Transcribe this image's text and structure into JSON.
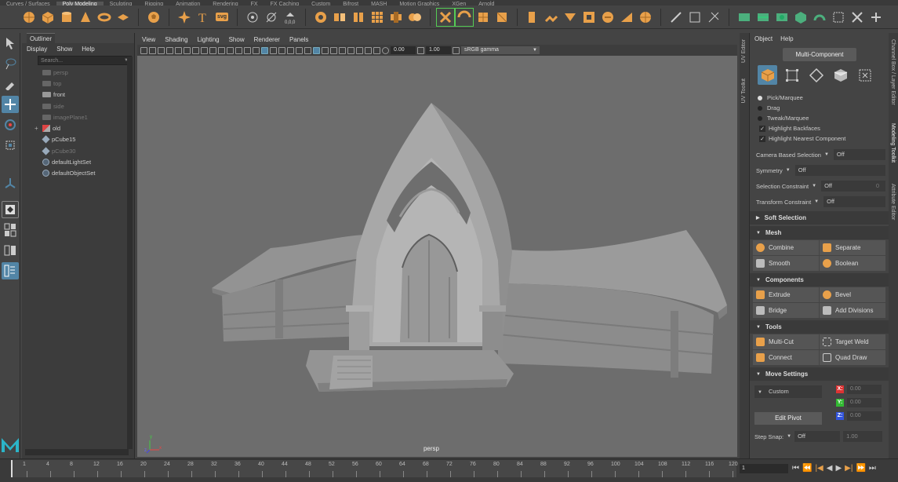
{
  "shelf": {
    "tabs": [
      "Curves / Surfaces",
      "Poly Modeling",
      "Sculpting",
      "Rigging",
      "Animation",
      "Rendering",
      "FX",
      "FX Caching",
      "Custom",
      "Bifrost",
      "MASH",
      "Motion Graphics",
      "XGen",
      "Arnold"
    ],
    "active_tab": "Poly Modeling",
    "svg_label": "svg"
  },
  "outliner": {
    "title": "Outliner",
    "menu": [
      "Display",
      "Show",
      "Help"
    ],
    "search_placeholder": "Search...",
    "items": [
      {
        "label": "persp",
        "dim": true
      },
      {
        "label": "top",
        "dim": true
      },
      {
        "label": "front",
        "dim": false
      },
      {
        "label": "side",
        "dim": true
      },
      {
        "label": "imagePlane1",
        "dim": true
      },
      {
        "label": "old",
        "dim": false
      },
      {
        "label": "pCube15",
        "dim": false
      },
      {
        "label": "pCube30",
        "dim": true
      },
      {
        "label": "defaultLightSet",
        "dim": false
      },
      {
        "label": "defaultObjectSet",
        "dim": false
      }
    ],
    "expand_symbol": "+"
  },
  "viewport": {
    "menu": [
      "View",
      "Shading",
      "Lighting",
      "Show",
      "Renderer",
      "Panels"
    ],
    "exposure": "0.00",
    "gamma": "1.00",
    "color_space": "sRGB gamma",
    "camera_label": "persp",
    "axis_y": "y",
    "axis_x": "x",
    "axis_z": "z"
  },
  "timeline": {
    "ticks": [
      "1",
      "4",
      "8",
      "12",
      "16",
      "20",
      "24",
      "28",
      "32",
      "36",
      "40",
      "44",
      "48",
      "52",
      "56",
      "60",
      "64",
      "68",
      "72",
      "76",
      "80",
      "84",
      "88",
      "92",
      "96",
      "100",
      "104",
      "108",
      "112",
      "116",
      "120"
    ],
    "current_frame": "1"
  },
  "side_tabs": {
    "left": [
      "UV Editor",
      "UV Toolkit"
    ],
    "right": [
      "Channel Box / Layer Editor",
      "Modeling Toolkit",
      "Attribute Editor"
    ]
  },
  "toolkit": {
    "menu": [
      "Object",
      "Help"
    ],
    "multi_component": "Multi-Component",
    "pick_options": [
      {
        "label": "Pick/Marquee",
        "on": true
      },
      {
        "label": "Drag",
        "on": false
      },
      {
        "label": "Tweak/Marquee",
        "on": false
      }
    ],
    "checks": [
      "Highlight Backfaces",
      "Highlight Nearest Component"
    ],
    "check_mark": "✓",
    "dropdowns": [
      {
        "label": "Camera Based Selection",
        "value": "Off",
        "extra": ""
      },
      {
        "label": "Symmetry",
        "value": "Off",
        "extra": ""
      },
      {
        "label": "Selection Constraint",
        "value": "Off",
        "extra": "0"
      },
      {
        "label": "Transform Constraint",
        "value": "Off",
        "extra": ""
      }
    ],
    "soft_selection": "Soft Selection",
    "mesh": {
      "title": "Mesh",
      "buttons": [
        "Combine",
        "Separate",
        "Smooth",
        "Boolean"
      ]
    },
    "components": {
      "title": "Components",
      "buttons": [
        "Extrude",
        "Bevel",
        "Bridge",
        "Add Divisions"
      ]
    },
    "tools": {
      "title": "Tools",
      "buttons": [
        "Multi-Cut",
        "Target Weld",
        "Connect",
        "Quad Draw"
      ]
    },
    "move_settings": {
      "title": "Move Settings",
      "mode": "Custom",
      "x_label": "X:",
      "y_label": "Y:",
      "z_label": "Z:",
      "x": "0.00",
      "y": "0.00",
      "z": "0.00",
      "edit_pivot": "Edit Pivot",
      "step_snap_label": "Step Snap:",
      "step_snap_value": "Off",
      "step_snap_amount": "1.00"
    }
  },
  "colors": {
    "accent": "#5285a6",
    "orange": "#e8a04a",
    "maya_logo": "#2bb5c9"
  }
}
